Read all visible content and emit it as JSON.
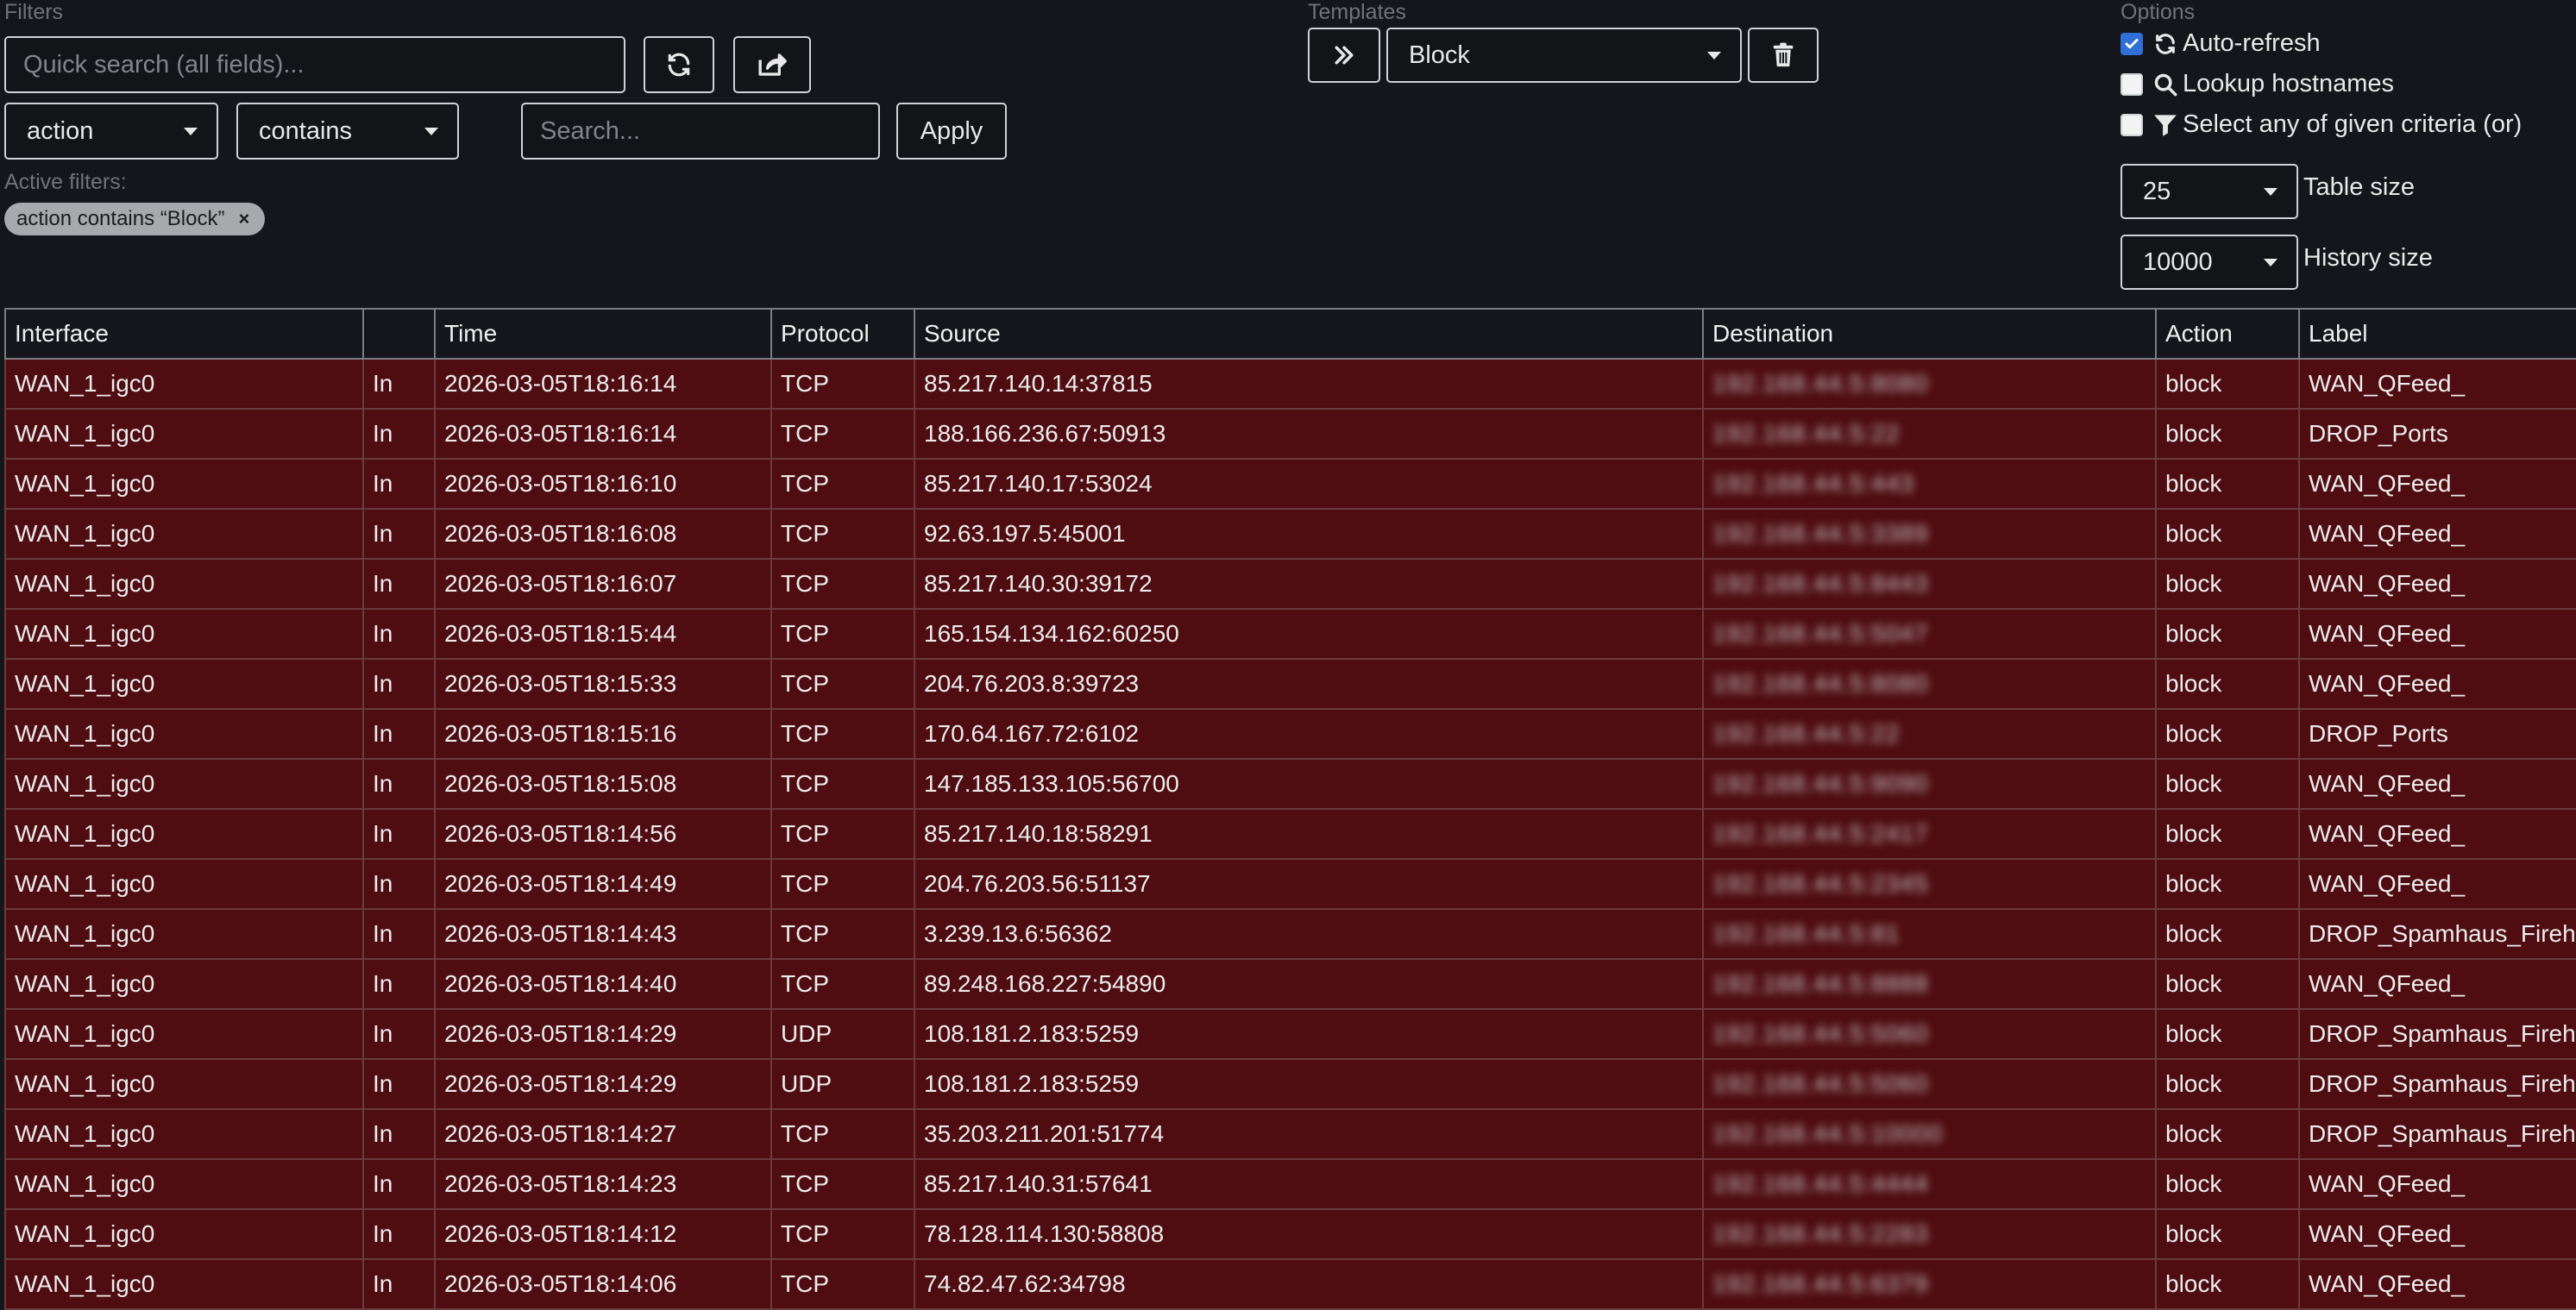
{
  "filters": {
    "label": "Filters",
    "quick_search_placeholder": "Quick search (all fields)...",
    "field_select": "action",
    "operator_select": "contains",
    "value_placeholder": "Search...",
    "apply_label": "Apply",
    "active_label": "Active filters:",
    "active_chip": "action contains “Block”",
    "chip_remove": "×"
  },
  "templates": {
    "label": "Templates",
    "selected": "Block"
  },
  "options": {
    "label": "Options",
    "auto_refresh": "Auto-refresh",
    "auto_refresh_checked": true,
    "lookup_hostnames": "Lookup hostnames",
    "lookup_hostnames_checked": false,
    "select_any": "Select any of given criteria (or)",
    "select_any_checked": false,
    "table_size_value": "25",
    "table_size_label": "Table size",
    "history_size_value": "10000",
    "history_size_label": "History size"
  },
  "icons": {
    "refresh": "refresh-icon",
    "export": "export-icon",
    "apply_template": "double-chevron-icon",
    "delete_template": "trash-icon",
    "search": "search-icon",
    "filter": "filter-icon"
  },
  "colors": {
    "row_block": "#4f0d12",
    "checkbox_checked": "#2f6fd6"
  },
  "table": {
    "columns": [
      "Interface",
      "",
      "Time",
      "Protocol",
      "Source",
      "Destination",
      "Action",
      "Label"
    ],
    "rows": [
      [
        "WAN_1_igc0",
        "In",
        "2026-03-05T18:16:14",
        "TCP",
        "85.217.140.14:37815",
        "192.168.44.5:8080",
        "block",
        "WAN_QFeed_"
      ],
      [
        "WAN_1_igc0",
        "In",
        "2026-03-05T18:16:14",
        "TCP",
        "188.166.236.67:50913",
        "192.168.44.5:22",
        "block",
        "DROP_Ports"
      ],
      [
        "WAN_1_igc0",
        "In",
        "2026-03-05T18:16:10",
        "TCP",
        "85.217.140.17:53024",
        "192.168.44.5:443",
        "block",
        "WAN_QFeed_"
      ],
      [
        "WAN_1_igc0",
        "In",
        "2026-03-05T18:16:08",
        "TCP",
        "92.63.197.5:45001",
        "192.168.44.5:3389",
        "block",
        "WAN_QFeed_"
      ],
      [
        "WAN_1_igc0",
        "In",
        "2026-03-05T18:16:07",
        "TCP",
        "85.217.140.30:39172",
        "192.168.44.5:8443",
        "block",
        "WAN_QFeed_"
      ],
      [
        "WAN_1_igc0",
        "In",
        "2026-03-05T18:15:44",
        "TCP",
        "165.154.134.162:60250",
        "192.168.44.5:5047",
        "block",
        "WAN_QFeed_"
      ],
      [
        "WAN_1_igc0",
        "In",
        "2026-03-05T18:15:33",
        "TCP",
        "204.76.203.8:39723",
        "192.168.44.5:8080",
        "block",
        "WAN_QFeed_"
      ],
      [
        "WAN_1_igc0",
        "In",
        "2026-03-05T18:15:16",
        "TCP",
        "170.64.167.72:6102",
        "192.168.44.5:22",
        "block",
        "DROP_Ports"
      ],
      [
        "WAN_1_igc0",
        "In",
        "2026-03-05T18:15:08",
        "TCP",
        "147.185.133.105:56700",
        "192.168.44.5:9090",
        "block",
        "WAN_QFeed_"
      ],
      [
        "WAN_1_igc0",
        "In",
        "2026-03-05T18:14:56",
        "TCP",
        "85.217.140.18:58291",
        "192.168.44.5:2417",
        "block",
        "WAN_QFeed_"
      ],
      [
        "WAN_1_igc0",
        "In",
        "2026-03-05T18:14:49",
        "TCP",
        "204.76.203.56:51137",
        "192.168.44.5:2345",
        "block",
        "WAN_QFeed_"
      ],
      [
        "WAN_1_igc0",
        "In",
        "2026-03-05T18:14:43",
        "TCP",
        "3.239.13.6:56362",
        "192.168.44.5:81",
        "block",
        "DROP_Spamhaus_Fireh"
      ],
      [
        "WAN_1_igc0",
        "In",
        "2026-03-05T18:14:40",
        "TCP",
        "89.248.168.227:54890",
        "192.168.44.5:8888",
        "block",
        "WAN_QFeed_"
      ],
      [
        "WAN_1_igc0",
        "In",
        "2026-03-05T18:14:29",
        "UDP",
        "108.181.2.183:5259",
        "192.168.44.5:5060",
        "block",
        "DROP_Spamhaus_Fireh"
      ],
      [
        "WAN_1_igc0",
        "In",
        "2026-03-05T18:14:29",
        "UDP",
        "108.181.2.183:5259",
        "192.168.44.5:5060",
        "block",
        "DROP_Spamhaus_Fireh"
      ],
      [
        "WAN_1_igc0",
        "In",
        "2026-03-05T18:14:27",
        "TCP",
        "35.203.211.201:51774",
        "192.168.44.5:10000",
        "block",
        "DROP_Spamhaus_Fireh"
      ],
      [
        "WAN_1_igc0",
        "In",
        "2026-03-05T18:14:23",
        "TCP",
        "85.217.140.31:57641",
        "192.168.44.5:4444",
        "block",
        "WAN_QFeed_"
      ],
      [
        "WAN_1_igc0",
        "In",
        "2026-03-05T18:14:12",
        "TCP",
        "78.128.114.130:58808",
        "192.168.44.5:2283",
        "block",
        "WAN_QFeed_"
      ],
      [
        "WAN_1_igc0",
        "In",
        "2026-03-05T18:14:06",
        "TCP",
        "74.82.47.62:34798",
        "192.168.44.5:6379",
        "block",
        "WAN_QFeed_"
      ]
    ]
  }
}
